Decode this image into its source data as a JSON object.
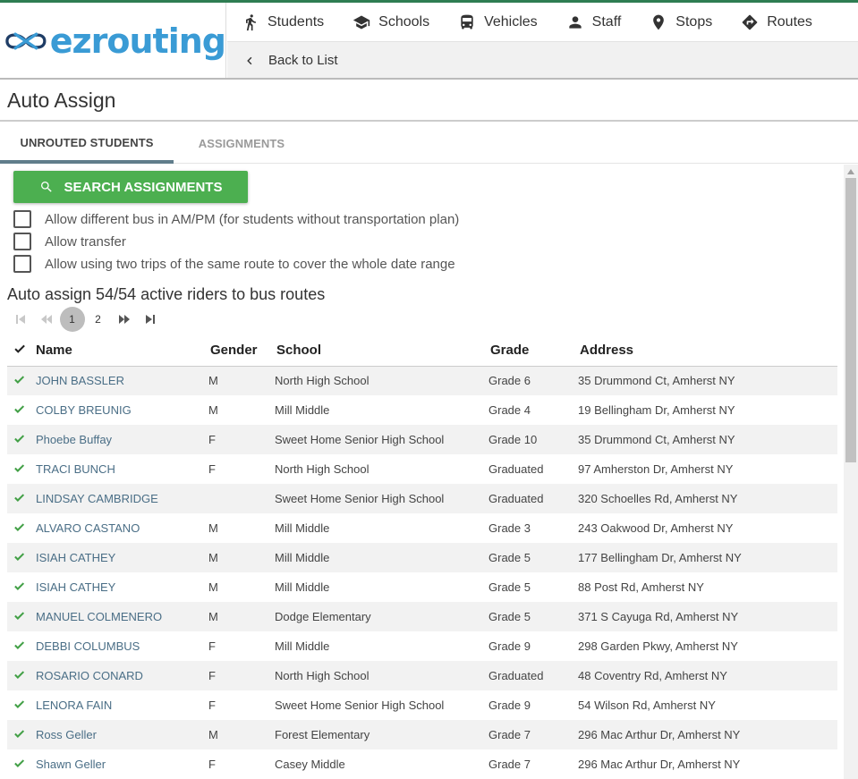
{
  "app": {
    "logo_text": "ezrouting",
    "brand_color": "#3a9bd5",
    "accent_green": "#4caf50"
  },
  "nav": {
    "items": [
      {
        "label": "Students",
        "icon": "walking-person-icon"
      },
      {
        "label": "Schools",
        "icon": "graduation-cap-icon"
      },
      {
        "label": "Vehicles",
        "icon": "bus-icon"
      },
      {
        "label": "Staff",
        "icon": "person-icon"
      },
      {
        "label": "Stops",
        "icon": "map-pin-icon"
      },
      {
        "label": "Routes",
        "icon": "directions-icon"
      }
    ],
    "back_label": "Back to List"
  },
  "page": {
    "title": "Auto Assign"
  },
  "tabs": [
    {
      "label": "UNROUTED STUDENTS",
      "active": true
    },
    {
      "label": "ASSIGNMENTS",
      "active": false
    }
  ],
  "search_button": "SEARCH ASSIGNMENTS",
  "options": [
    {
      "label": "Allow different bus in AM/PM (for students without transportation plan)",
      "checked": false
    },
    {
      "label": "Allow transfer",
      "checked": false
    },
    {
      "label": "Allow using two trips of the same route to cover the whole date range",
      "checked": false
    }
  ],
  "summary": "Auto assign 54/54 active riders to bus routes",
  "pager": {
    "pages": [
      "1",
      "2"
    ],
    "current": "1"
  },
  "table": {
    "columns": [
      "Name",
      "Gender",
      "School",
      "Grade",
      "Address"
    ],
    "rows": [
      {
        "name": "JOHN BASSLER",
        "gender": "M",
        "school": "North High School",
        "grade": "Grade 6",
        "address": "35 Drummond Ct, Amherst NY"
      },
      {
        "name": "COLBY BREUNIG",
        "gender": "M",
        "school": "Mill Middle",
        "grade": "Grade 4",
        "address": "19 Bellingham Dr, Amherst NY"
      },
      {
        "name": "Phoebe Buffay",
        "gender": "F",
        "school": "Sweet Home Senior High School",
        "grade": "Grade 10",
        "address": "35 Drummond Ct, Amherst NY"
      },
      {
        "name": "TRACI BUNCH",
        "gender": "F",
        "school": "North High School",
        "grade": "Graduated",
        "address": "97 Amherston Dr, Amherst NY"
      },
      {
        "name": "LINDSAY CAMBRIDGE",
        "gender": "",
        "school": "Sweet Home Senior High School",
        "grade": "Graduated",
        "address": "320 Schoelles Rd, Amherst NY"
      },
      {
        "name": "ALVARO CASTANO",
        "gender": "M",
        "school": "Mill Middle",
        "grade": "Grade 3",
        "address": "243 Oakwood Dr, Amherst NY"
      },
      {
        "name": "ISIAH CATHEY",
        "gender": "M",
        "school": "Mill Middle",
        "grade": "Grade 5",
        "address": "177 Bellingham Dr, Amherst NY"
      },
      {
        "name": "ISIAH CATHEY",
        "gender": "M",
        "school": "Mill Middle",
        "grade": "Grade 5",
        "address": "88 Post Rd, Amherst NY"
      },
      {
        "name": "MANUEL COLMENERO",
        "gender": "M",
        "school": "Dodge Elementary",
        "grade": "Grade 5",
        "address": "371 S Cayuga Rd, Amherst NY"
      },
      {
        "name": "DEBBI COLUMBUS",
        "gender": "F",
        "school": "Mill Middle",
        "grade": "Grade 9",
        "address": "298 Garden Pkwy, Amherst NY"
      },
      {
        "name": "ROSARIO CONARD",
        "gender": "F",
        "school": "North High School",
        "grade": "Graduated",
        "address": "48 Coventry Rd, Amherst NY"
      },
      {
        "name": "LENORA FAIN",
        "gender": "F",
        "school": "Sweet Home Senior High School",
        "grade": "Grade 9",
        "address": "54 Wilson Rd, Amherst NY"
      },
      {
        "name": "Ross Geller",
        "gender": "M",
        "school": "Forest Elementary",
        "grade": "Grade 7",
        "address": "296 Mac Arthur Dr, Amherst NY"
      },
      {
        "name": "Shawn Geller",
        "gender": "F",
        "school": "Casey Middle",
        "grade": "Grade 7",
        "address": "296 Mac Arthur Dr, Amherst NY"
      }
    ]
  }
}
